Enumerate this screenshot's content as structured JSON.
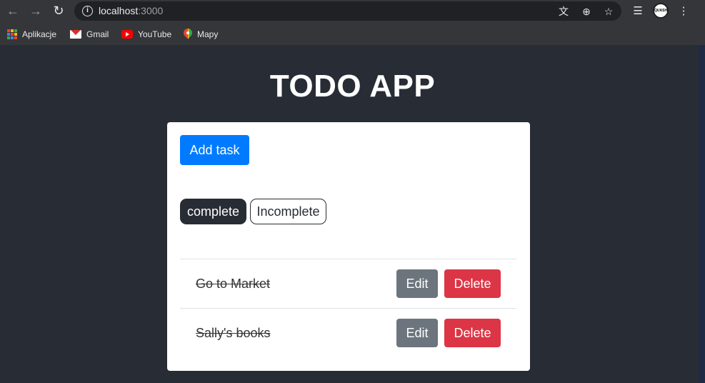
{
  "browser": {
    "url_host": "localhost",
    "url_port": ":3000",
    "avatar_text": "QUASH",
    "bookmarks": [
      {
        "label": "Aplikacje",
        "icon": "apps-grid-icon"
      },
      {
        "label": "Gmail",
        "icon": "gmail-icon"
      },
      {
        "label": "YouTube",
        "icon": "youtube-icon"
      },
      {
        "label": "Mapy",
        "icon": "maps-icon"
      }
    ]
  },
  "app": {
    "title": "TODO APP",
    "add_task_label": "Add task",
    "filters": {
      "complete_label": "complete",
      "incomplete_label": "Incomplete",
      "active": "complete"
    },
    "tasks": [
      {
        "text": "Go to Market",
        "completed": true,
        "edit_label": "Edit",
        "delete_label": "Delete"
      },
      {
        "text": "Sally's books",
        "completed": true,
        "edit_label": "Edit",
        "delete_label": "Delete"
      }
    ]
  },
  "colors": {
    "page_bg": "#282c34",
    "primary": "#007bff",
    "secondary": "#6c757d",
    "danger": "#dc3545"
  }
}
